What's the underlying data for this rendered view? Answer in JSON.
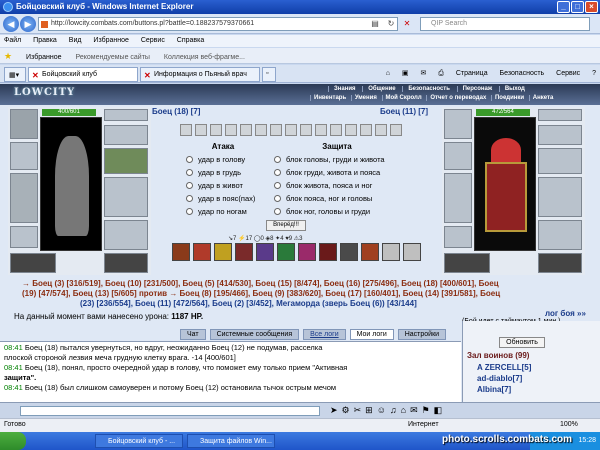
{
  "window": {
    "title": "Бойцовский клуб - Windows Internet Explorer",
    "url": "http://lowcity.combats.com/buttons.pl?battle=0.188237579370661",
    "search_placeholder": "QIP Search"
  },
  "menu": [
    "Файл",
    "Правка",
    "Вид",
    "Избранное",
    "Сервис",
    "Справка"
  ],
  "favbar": {
    "favorites": "Избранное",
    "suggested": "Рекомендуемые сайты",
    "gallery": "Коллекция веб-фрагме..."
  },
  "tabs": [
    {
      "label": "Бойцовский клуб"
    },
    {
      "label": "Информация о Пьяный врач"
    }
  ],
  "toolbar": {
    "page": "Страница",
    "safety": "Безопасность",
    "tools": "Сервис"
  },
  "game": {
    "logo": "LOWCITY",
    "nav_top": [
      "Знания",
      "Общение",
      "Безопасность",
      "Персонаж",
      "Выход"
    ],
    "nav_bottom": [
      "Инвентарь",
      "Умения",
      "Мой Скролл",
      "Отчет о переводах",
      "Поединки",
      "Анкета"
    ]
  },
  "left_fighter": {
    "name": "Боец (18) [7]",
    "hp": "400/601"
  },
  "right_fighter": {
    "name": "Боец (11) [7]",
    "hp": "472/564"
  },
  "attack": {
    "title": "Атака",
    "options": [
      "удар в голову",
      "удар в грудь",
      "удар в живот",
      "удар в пояс(пах)",
      "удар по ногам"
    ]
  },
  "defense": {
    "title": "Защита",
    "options": [
      "блок головы, груди и живота",
      "блок груди, живота и пояса",
      "блок живота, пояса и ног",
      "блок пояса, ног и головы",
      "блок ног, головы и груди"
    ]
  },
  "go_button": "Вперёд!!!",
  "counts": "↘7  ⚡17  ◯0  ◈8  ✦4  ♥9  ⚠3",
  "battle_line1": "→ Боец (3) [316/519], Боец (10) [231/500], Боец (5) [414/530], Боец (15) [8/474], Боец (16) [275/496], Боец (18) [400/601], Боец",
  "battle_line2": "(19) [47/574], Боец (13) [5/605]  против  → Боец (8) [195/466], Боец (9) [383/620], Боец (17) [160/401], Боец (14) [391/581], Боец",
  "battle_line3": "(23) [236/554], Боец (11) [472/564], Боец (2) [3/452], Мегаморда (зверь Боец (6)) [43/144]",
  "damage_label": "На данный момент вами нанесено урона:",
  "damage_value": "1187 HP.",
  "battle_log_link": "лог боя »»",
  "timeout": "(Бой идет с таймаутом 1 мин.)",
  "log_tabs": [
    "Чат",
    "Системные сообщения",
    "Все логи",
    "Мои логи",
    "Настройки"
  ],
  "log": [
    {
      "time": "08:41",
      "text": "Боец (18) пытался увернуться, но вдруг, неожиданно Боец (12) не подумав, расселка"
    },
    {
      "time": "",
      "text": "плоской стороной лезвия меча грудную клетку врага. -14 [400/601]"
    },
    {
      "time": "08:41",
      "text": "Боец (18), понял, просто очередной удар в голову, что поможет ему только прием \"Активная"
    },
    {
      "time": "",
      "text": "защита\"."
    },
    {
      "time": "08:41",
      "text": "Боец (18) был слишком самоуверен и потому Боец (12) остановила тычок острым мечом"
    }
  ],
  "side": {
    "refresh": "Обновить",
    "hall": "Зал воинов (99)",
    "players": [
      "A ZERCELL[5]",
      "ad-diablo[7]",
      "Albina[7]"
    ]
  },
  "status": {
    "ready": "Готово",
    "zone": "Интернет",
    "zoom": "100%"
  },
  "taskbar": {
    "items": [
      "Бойцовский клуб - ...",
      "Защита файлов Win..."
    ],
    "clock": "15:28"
  },
  "watermark": "photo.scrolls.combats.com"
}
